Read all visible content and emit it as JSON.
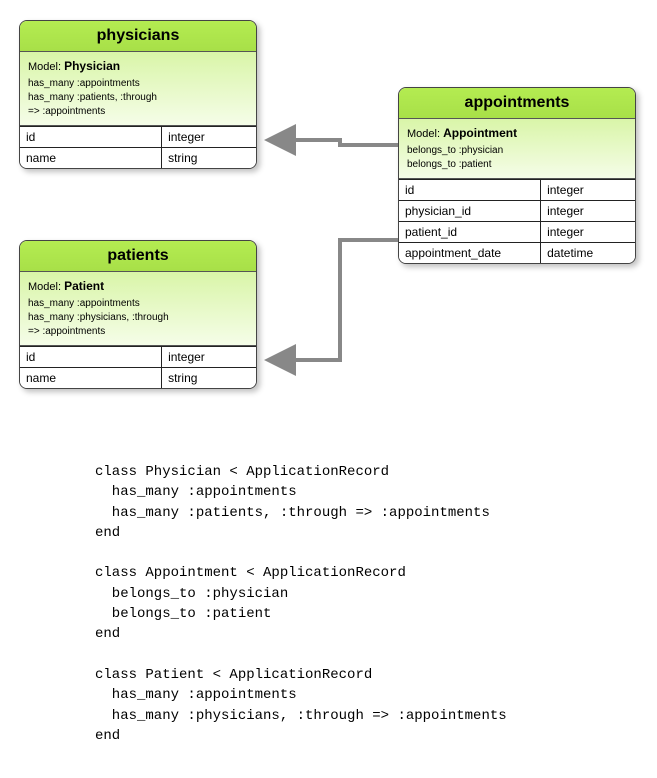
{
  "entities": {
    "physicians": {
      "title": "physicians",
      "model_label": "Model:",
      "model_name": "Physician",
      "associations": [
        "has_many :appointments",
        "has_many :patients, :through",
        "=> :appointments"
      ],
      "columns": [
        {
          "name": "id",
          "type": "integer"
        },
        {
          "name": "name",
          "type": "string"
        }
      ]
    },
    "patients": {
      "title": "patients",
      "model_label": "Model:",
      "model_name": "Patient",
      "associations": [
        "has_many :appointments",
        "has_many :physicians, :through",
        "=> :appointments"
      ],
      "columns": [
        {
          "name": "id",
          "type": "integer"
        },
        {
          "name": "name",
          "type": "string"
        }
      ]
    },
    "appointments": {
      "title": "appointments",
      "model_label": "Model:",
      "model_name": "Appointment",
      "associations": [
        "belongs_to :physician",
        "belongs_to :patient"
      ],
      "columns": [
        {
          "name": "id",
          "type": "integer"
        },
        {
          "name": "physician_id",
          "type": "integer"
        },
        {
          "name": "patient_id",
          "type": "integer"
        },
        {
          "name": "appointment_date",
          "type": "datetime"
        }
      ]
    }
  },
  "code": "class Physician < ApplicationRecord\n  has_many :appointments\n  has_many :patients, :through => :appointments\nend\n\nclass Appointment < ApplicationRecord\n  belongs_to :physician\n  belongs_to :patient\nend\n\nclass Patient < ApplicationRecord\n  has_many :appointments\n  has_many :physicians, :through => :appointments\nend"
}
